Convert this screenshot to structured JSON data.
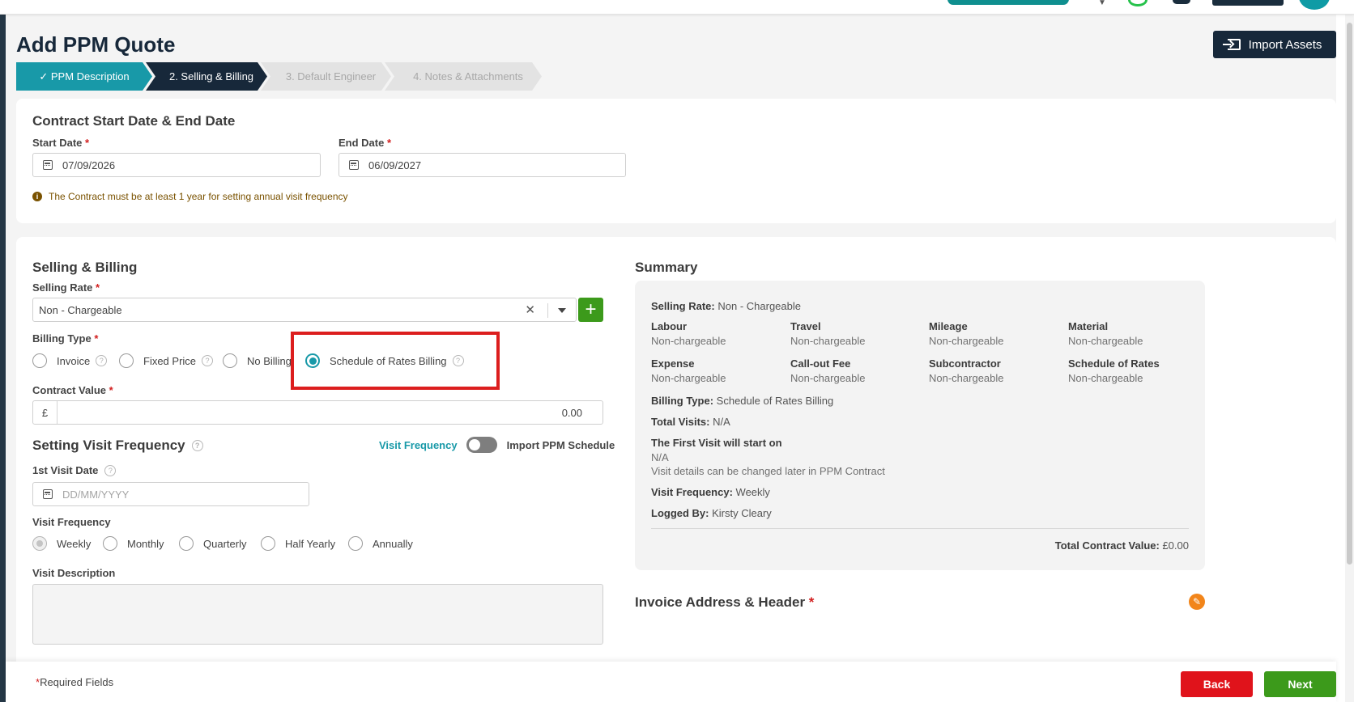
{
  "page": {
    "title": "Add PPM Quote",
    "import_button": "Import Assets"
  },
  "steps": [
    {
      "label": "✓ PPM Description",
      "state": "done"
    },
    {
      "label": "2. Selling & Billing",
      "state": "active"
    },
    {
      "label": "3. Default Engineer",
      "state": "todo"
    },
    {
      "label": "4. Notes & Attachments",
      "state": "todo"
    }
  ],
  "contract": {
    "title": "Contract Start Date & End Date",
    "start_label": "Start Date",
    "start_value": "07/09/2026",
    "end_label": "End Date",
    "end_value": "06/09/2027",
    "note": "The Contract must be at least 1 year for setting annual visit frequency"
  },
  "selling": {
    "title": "Selling & Billing",
    "rate_label": "Selling Rate",
    "rate_value": "Non - Chargeable",
    "billing_label": "Billing Type",
    "billing_options": [
      "Invoice",
      "Fixed Price",
      "No Billing",
      "Schedule of Rates Billing"
    ],
    "billing_selected": "Schedule of Rates Billing",
    "contract_value_label": "Contract Value",
    "currency": "£",
    "contract_value": "0.00"
  },
  "visit": {
    "title": "Setting Visit Frequency",
    "toggle_left": "Visit Frequency",
    "toggle_right": "Import PPM Schedule",
    "first_visit_label": "1st Visit Date",
    "first_visit_placeholder": "DD/MM/YYYY",
    "freq_label": "Visit Frequency",
    "freq_options": [
      "Weekly",
      "Monthly",
      "Quarterly",
      "Half Yearly",
      "Annually"
    ],
    "freq_selected": "Weekly",
    "desc_label": "Visit Description"
  },
  "summary": {
    "title": "Summary",
    "selling_rate_key": "Selling Rate:",
    "selling_rate_val": "Non - Chargeable",
    "grid": [
      {
        "head": "Labour",
        "val": "Non-chargeable"
      },
      {
        "head": "Travel",
        "val": "Non-chargeable"
      },
      {
        "head": "Mileage",
        "val": "Non-chargeable"
      },
      {
        "head": "Material",
        "val": "Non-chargeable"
      },
      {
        "head": "Expense",
        "val": "Non-chargeable"
      },
      {
        "head": "Call-out Fee",
        "val": "Non-chargeable"
      },
      {
        "head": "Subcontractor",
        "val": "Non-chargeable"
      },
      {
        "head": "Schedule of Rates",
        "val": "Non-chargeable"
      }
    ],
    "billing_type_key": "Billing Type:",
    "billing_type_val": "Schedule of Rates Billing",
    "total_visits_key": "Total Visits:",
    "total_visits_val": "N/A",
    "first_visit_head": "The First Visit will start on",
    "first_visit_val": "N/A",
    "first_visit_note": "Visit details can be changed later in PPM Contract",
    "visit_freq_key": "Visit Frequency:",
    "visit_freq_val": "Weekly",
    "logged_by_key": "Logged By:",
    "logged_by_val": "Kirsty Cleary",
    "total_key": "Total Contract Value:",
    "total_val": "£0.00"
  },
  "invoice": {
    "title": "Invoice Address & Header"
  },
  "footer": {
    "required_note": "Required Fields",
    "back": "Back",
    "next": "Next"
  },
  "colors": {
    "navy": "#17283a",
    "teal": "#1899a8",
    "green": "#3c9a1b",
    "red": "#e0131b",
    "highlight": "#dc1e1e"
  }
}
